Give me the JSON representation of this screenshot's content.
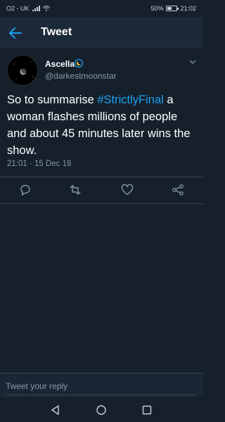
{
  "status_bar": {
    "carrier": "O2 - UK",
    "battery": "50%",
    "time": "21:02"
  },
  "header": {
    "title": "Tweet",
    "back_icon": "arrow-left-icon"
  },
  "tweet": {
    "display_name": "Ascella",
    "handle": "@darkestmoonstar",
    "text_before": "So to summarise ",
    "hashtag": "#StrictlyFinal",
    "text_after": " a woman flashes millions of people and about 45 minutes later wins the show.",
    "timestamp": "21:01 · 15 Dec 18"
  },
  "actions": {
    "icons": [
      "reply-icon",
      "retweet-icon",
      "like-icon",
      "share-icon"
    ]
  },
  "reply": {
    "placeholder": "Tweet your reply"
  },
  "nav": {
    "icons": [
      "back-triangle-icon",
      "home-circle-icon",
      "recents-square-icon"
    ]
  },
  "colors": {
    "background": "#15202b",
    "header": "#1c2938",
    "accent": "#1da1f2",
    "secondary_text": "#8899a6",
    "divider": "#38444d"
  }
}
